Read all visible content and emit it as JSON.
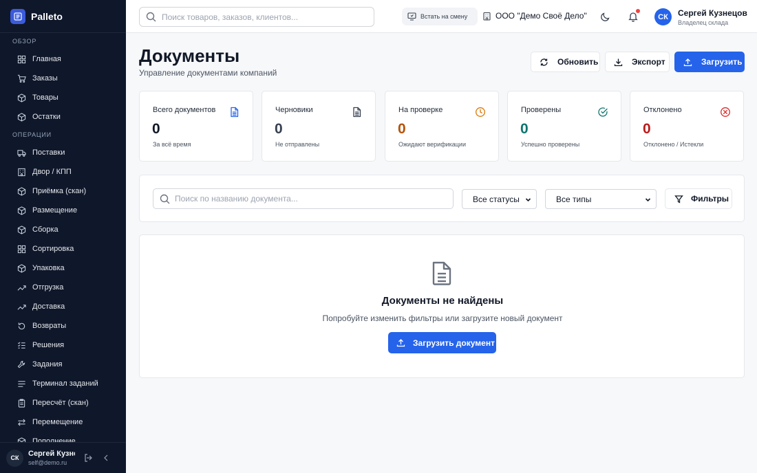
{
  "brand": {
    "name": "Palleto"
  },
  "sidebar": {
    "sections": [
      {
        "title": "ОБЗОР",
        "items": [
          {
            "label": "Главная",
            "icon": "grid-icon"
          },
          {
            "label": "Заказы",
            "icon": "cart-icon"
          },
          {
            "label": "Товары",
            "icon": "box-icon"
          },
          {
            "label": "Остатки",
            "icon": "box-icon"
          }
        ]
      },
      {
        "title": "ОПЕРАЦИИ",
        "items": [
          {
            "label": "Поставки",
            "icon": "truck-icon"
          },
          {
            "label": "Двор / КПП",
            "icon": "building-icon"
          },
          {
            "label": "Приёмка (скан)",
            "icon": "box-icon"
          },
          {
            "label": "Размещение",
            "icon": "box-icon"
          },
          {
            "label": "Сборка",
            "icon": "box-icon"
          },
          {
            "label": "Сортировка",
            "icon": "grid-icon"
          },
          {
            "label": "Упаковка",
            "icon": "box-icon"
          },
          {
            "label": "Отгрузка",
            "icon": "trend-up-icon"
          },
          {
            "label": "Доставка",
            "icon": "trend-up-icon"
          },
          {
            "label": "Возвраты",
            "icon": "return-icon"
          },
          {
            "label": "Решения",
            "icon": "list-check-icon"
          },
          {
            "label": "Задания",
            "icon": "wrench-icon"
          },
          {
            "label": "Терминал заданий",
            "icon": "list-icon"
          },
          {
            "label": "Пересчёт (скан)",
            "icon": "clipboard-icon"
          },
          {
            "label": "Перемещение",
            "icon": "arrows-icon"
          },
          {
            "label": "Пополнение",
            "icon": "box-icon"
          }
        ]
      }
    ],
    "user": {
      "initials": "СК",
      "name": "Сергей Кузнецов",
      "email": "self@demo.ru"
    }
  },
  "header": {
    "search_placeholder": "Поиск товаров, заказов, клиентов...",
    "shift_label": "Встать на смену",
    "company": "ООО \"Демо Своё Дело\"",
    "user": {
      "initials": "СК",
      "name": "Сергей Кузнецов",
      "role": "Владелец склада"
    }
  },
  "page": {
    "title": "Документы",
    "subtitle": "Управление документами компаний",
    "buttons": {
      "refresh": "Обновить",
      "export": "Экспорт",
      "upload": "Загрузить"
    }
  },
  "stats": [
    {
      "label": "Всего документов",
      "value": "0",
      "desc": "За всё время",
      "icon": "document-icon",
      "color": "#111827",
      "icon_color": "#2563eb"
    },
    {
      "label": "Черновики",
      "value": "0",
      "desc": "Не отправлены",
      "icon": "document-icon",
      "color": "#374151",
      "icon_color": "#374151"
    },
    {
      "label": "На проверке",
      "value": "0",
      "desc": "Ожидают верификации",
      "icon": "clock-icon",
      "color": "#b45309",
      "icon_color": "#d97706"
    },
    {
      "label": "Проверены",
      "value": "0",
      "desc": "Успешно проверены",
      "icon": "check-circle-icon",
      "color": "#0f766e",
      "icon_color": "#0f766e"
    },
    {
      "label": "Отклонено",
      "value": "0",
      "desc": "Отклонено / Истекли",
      "icon": "x-circle-icon",
      "color": "#b91c1c",
      "icon_color": "#dc2626"
    }
  ],
  "filters": {
    "search_placeholder": "Поиск по названию документа...",
    "status_value": "Все статусы",
    "type_value": "Все типы",
    "filters_label": "Фильтры"
  },
  "empty": {
    "title": "Документы не найдены",
    "subtitle": "Попробуйте изменить фильтры или загрузите новый документ",
    "button": "Загрузить документ"
  }
}
